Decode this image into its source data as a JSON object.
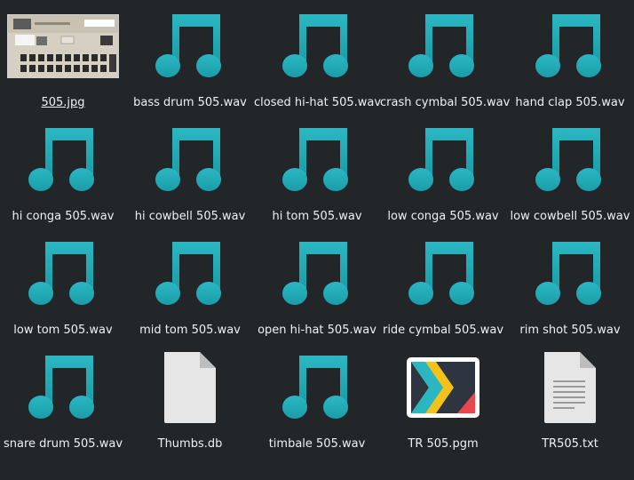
{
  "colors": {
    "background": "#232629",
    "text": "#eff0f1",
    "music_note": "#2bb7c2",
    "music_note_dark": "#1a9ea9",
    "doc_page": "#e6e6e6",
    "doc_fold": "#bdbdbd"
  },
  "files": [
    {
      "name": "505.jpg",
      "icon": "image-thumbnail-icon",
      "selected": true
    },
    {
      "name": "bass drum 505.wav",
      "icon": "audio-file-icon"
    },
    {
      "name": "closed hi-hat 505.wav",
      "icon": "audio-file-icon"
    },
    {
      "name": "crash cymbal 505.wav",
      "icon": "audio-file-icon"
    },
    {
      "name": "hand clap 505.wav",
      "icon": "audio-file-icon"
    },
    {
      "name": "hi conga 505.wav",
      "icon": "audio-file-icon"
    },
    {
      "name": "hi cowbell 505.wav",
      "icon": "audio-file-icon"
    },
    {
      "name": "hi tom 505.wav",
      "icon": "audio-file-icon"
    },
    {
      "name": "low conga 505.wav",
      "icon": "audio-file-icon"
    },
    {
      "name": "low cowbell 505.wav",
      "icon": "audio-file-icon"
    },
    {
      "name": "low tom 505.wav",
      "icon": "audio-file-icon"
    },
    {
      "name": "mid tom 505.wav",
      "icon": "audio-file-icon"
    },
    {
      "name": "open hi-hat 505.wav",
      "icon": "audio-file-icon"
    },
    {
      "name": "ride cymbal 505.wav",
      "icon": "audio-file-icon"
    },
    {
      "name": "rim shot 505.wav",
      "icon": "audio-file-icon"
    },
    {
      "name": "snare drum 505.wav",
      "icon": "audio-file-icon"
    },
    {
      "name": "Thumbs.db",
      "icon": "blank-document-icon"
    },
    {
      "name": "timbale 505.wav",
      "icon": "audio-file-icon"
    },
    {
      "name": "TR 505.pgm",
      "icon": "kdenlive-project-icon"
    },
    {
      "name": "TR505.txt",
      "icon": "text-document-icon"
    }
  ]
}
